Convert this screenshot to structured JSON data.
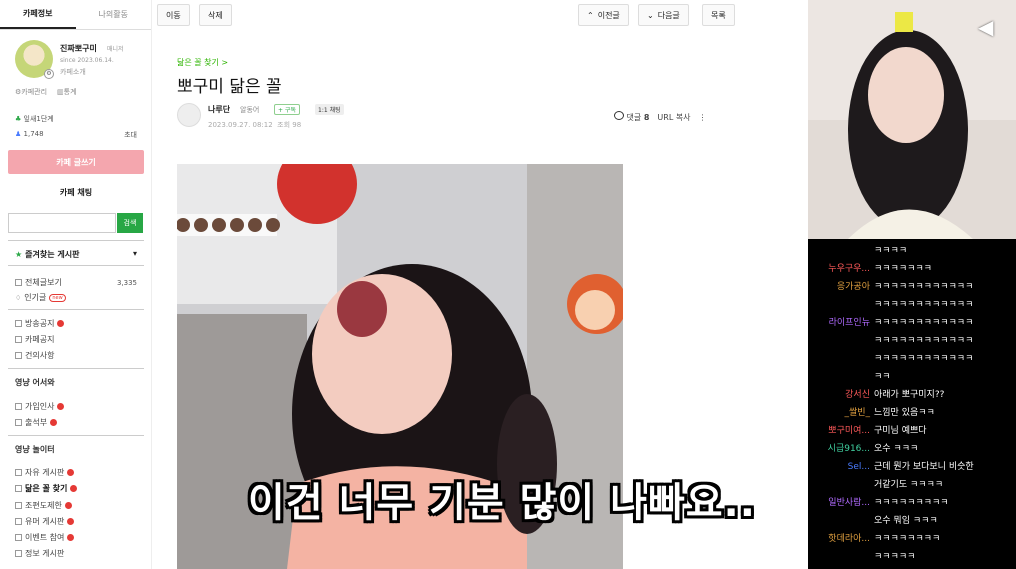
{
  "sidebar": {
    "tabs": [
      "카페정보",
      "나의활동"
    ],
    "profile": {
      "name": "진짜뽀구미",
      "grade": "매니저",
      "since": "since 2023.06.14.",
      "intro": "카페소개"
    },
    "links": [
      "카페관리",
      "통계"
    ],
    "level": "잎새1단계",
    "members": "1,748",
    "invite": "초대",
    "write_label": "카페 글쓰기",
    "chat_label": "카페 채팅",
    "search_button": "검색",
    "favorites_label": "즐겨찾는 게시판",
    "menu_main": [
      {
        "label": "전체글보기",
        "count": "3,335"
      },
      {
        "label": "인기글",
        "badge": "new"
      }
    ],
    "menu_notice": [
      {
        "label": "방송공지"
      },
      {
        "label": "카페공지"
      },
      {
        "label": "건의사항"
      }
    ],
    "section_welcome": "영냥 어서와",
    "menu_welcome": [
      {
        "label": "가입인사"
      },
      {
        "label": "출석부"
      }
    ],
    "section_play": "영냥 놀이터",
    "menu_play": [
      {
        "label": "자유 게시판"
      },
      {
        "label": "닮은 꼴 찾기"
      },
      {
        "label": "조편도제한"
      },
      {
        "label": "유머 게시판"
      },
      {
        "label": "이벤트 참여"
      },
      {
        "label": "정보 게시판"
      }
    ]
  },
  "toolbar": {
    "move": "이동",
    "delete": "삭제",
    "prev": "이전글",
    "next": "다음글",
    "list": "목록"
  },
  "post": {
    "breadcrumb": "닮은 꼴 찾기 >",
    "title": "뽀구미 닮은 꼴",
    "author": "나루단",
    "author_grade": "알동어",
    "follow": "+ 구독",
    "chat_chip": "1:1 채팅",
    "date": "2023.09.27. 08:12",
    "views": "조회 98",
    "comments_label": "댓글",
    "comments_count": "8",
    "url_copy": "URL 복사"
  },
  "subtitle": "이건 너무 기분 많이 나빠요..",
  "chat": [
    {
      "user": "",
      "msg": "ㅋㅋㅋㅋ",
      "color": "#4a7cff"
    },
    {
      "user": "누우구우...",
      "msg": "ㅋㅋㅋㅋㅋㅋㅋ",
      "color": "#ff5a5a"
    },
    {
      "user": "응가공아",
      "msg": "ㅋㅋㅋㅋㅋㅋㅋㅋㅋㅋㅋㅋ",
      "color": "#e0a040"
    },
    {
      "user": "",
      "msg": "ㅋㅋㅋㅋㅋㅋㅋㅋㅋㅋㅋㅋ",
      "color": "#fff"
    },
    {
      "user": "라이프인뉴",
      "msg": "ㅋㅋㅋㅋㅋㅋㅋㅋㅋㅋㅋㅋ",
      "color": "#b06bff"
    },
    {
      "user": "",
      "msg": "ㅋㅋㅋㅋㅋㅋㅋㅋㅋㅋㅋㅋ",
      "color": "#fff"
    },
    {
      "user": "",
      "msg": "ㅋㅋㅋㅋㅋㅋㅋㅋㅋㅋㅋㅋ",
      "color": "#fff"
    },
    {
      "user": "",
      "msg": "ㅋㅋ",
      "color": "#fff"
    },
    {
      "user": "강서신",
      "msg": "아래가 뽀구미지??",
      "color": "#ff5a5a"
    },
    {
      "user": "_쌀빈_",
      "msg": "느낌만 있음ㅋㅋ",
      "color": "#e0a040"
    },
    {
      "user": "뽀구미여...",
      "msg": "구미님 예쁘다",
      "color": "#ff5a5a"
    },
    {
      "user": "시급916...",
      "msg": "오수 ㅋㅋㅋ",
      "color": "#40d0a0"
    },
    {
      "user": "Sel...",
      "msg": "근데 뭔가 보다보니 비슷한",
      "color": "#4a7cff"
    },
    {
      "user": "",
      "msg": "거같기도 ㅋㅋㅋㅋ",
      "color": "#fff"
    },
    {
      "user": "일반사람...",
      "msg": "ㅋㅋㅋㅋㅋㅋㅋㅋㅋ",
      "color": "#b06bff"
    },
    {
      "user": "",
      "msg": "오수 뭐임 ㅋㅋㅋ",
      "color": "#4a7cff"
    },
    {
      "user": "핫데라아...",
      "msg": "ㅋㅋㅋㅋㅋㅋㅋㅋ",
      "color": "#e0a040"
    },
    {
      "user": "",
      "msg": "ㅋㅋㅋㅋㅋ",
      "color": "#fff"
    }
  ]
}
